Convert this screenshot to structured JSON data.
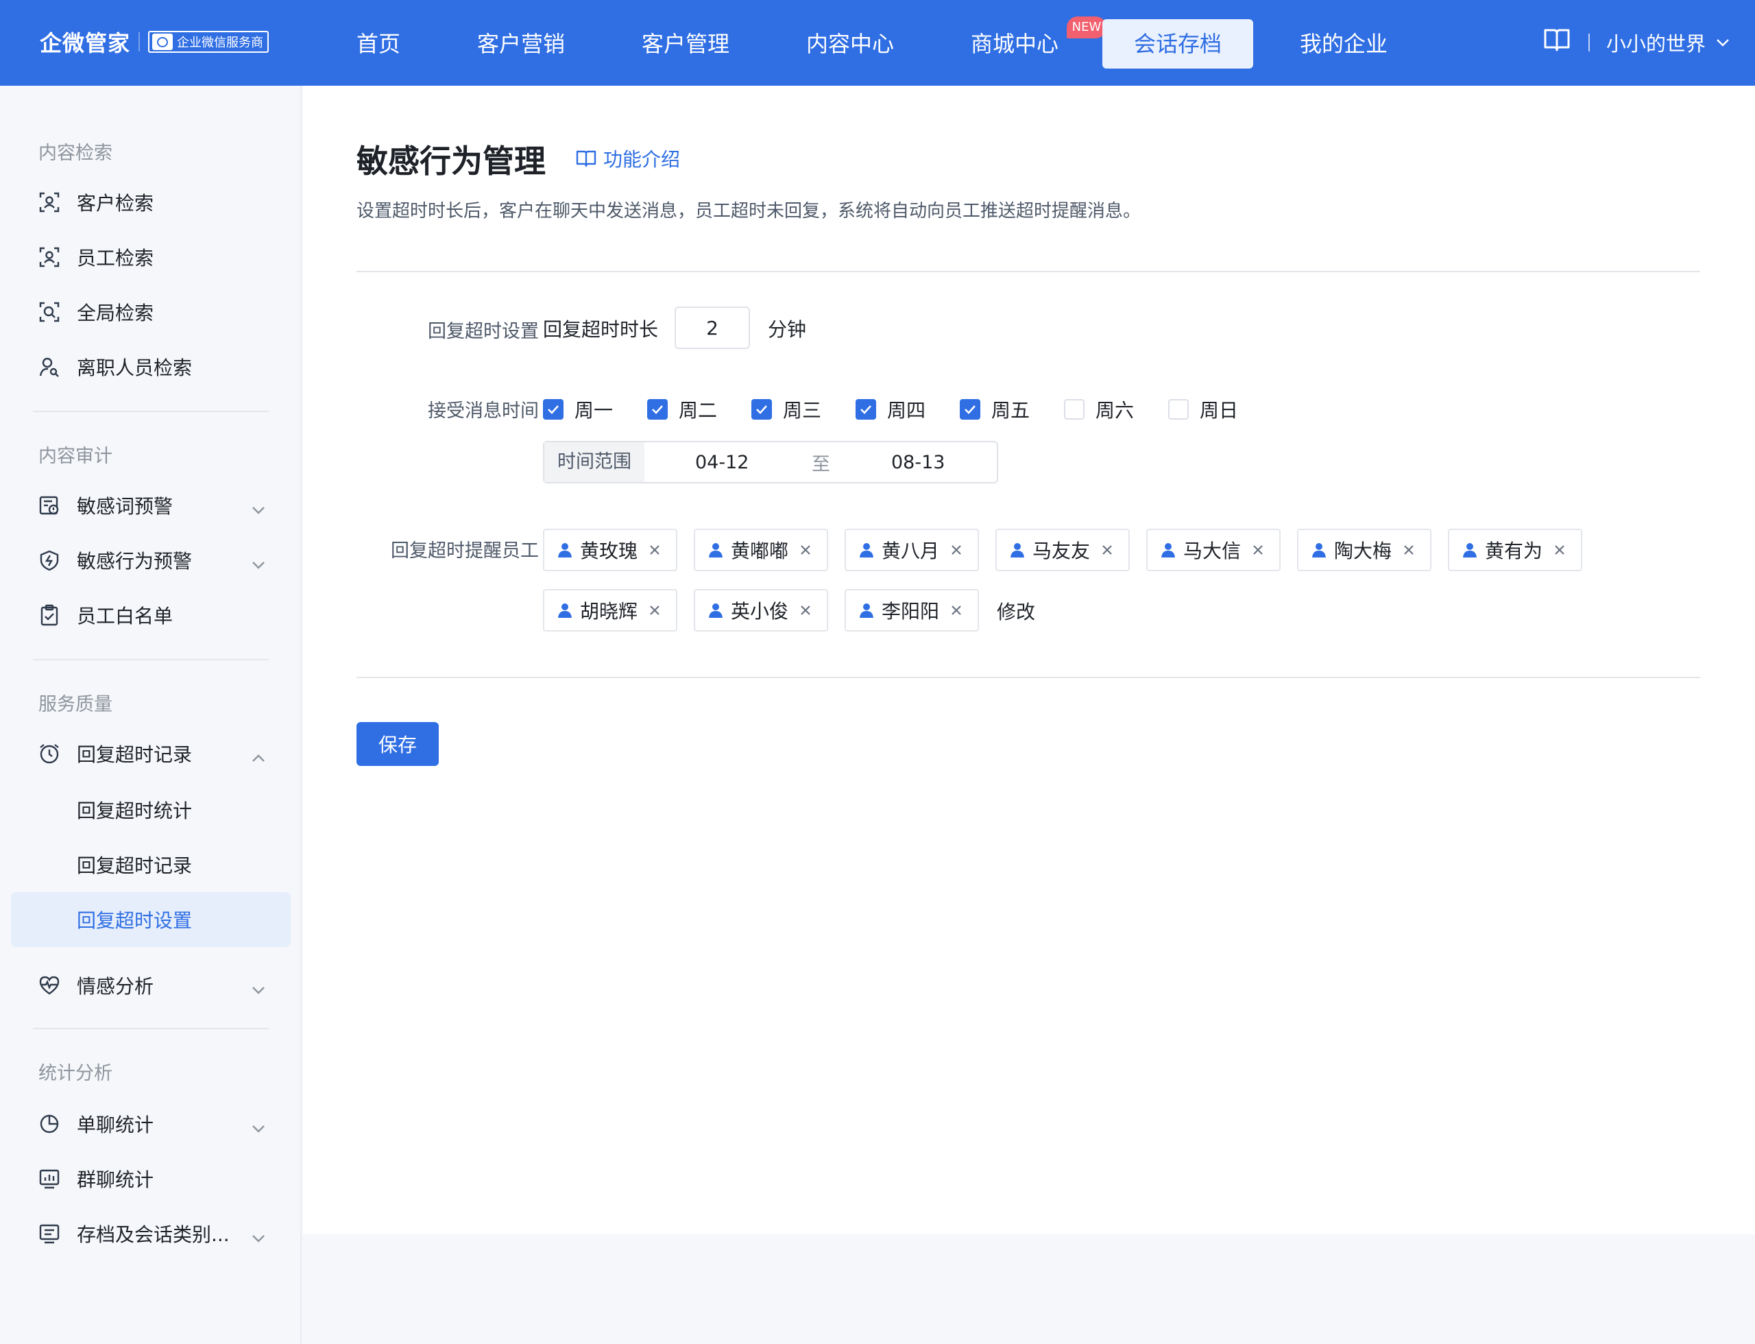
{
  "brand": {
    "name": "企微管家",
    "badge": "企业微信服务商"
  },
  "nav": {
    "items": [
      {
        "label": "首页"
      },
      {
        "label": "客户营销"
      },
      {
        "label": "客户管理"
      },
      {
        "label": "内容中心"
      },
      {
        "label": "商城中心"
      },
      {
        "label": "会话存档"
      },
      {
        "label": "我的企业"
      }
    ],
    "new_badge": "NEW",
    "active_index": 5,
    "user_name": "小小的世界"
  },
  "sidebar": {
    "groups": [
      {
        "title": "内容检索"
      },
      {
        "title": "内容审计"
      },
      {
        "title": "服务质量"
      },
      {
        "title": "统计分析"
      }
    ],
    "items": [
      {
        "label": "客户检索"
      },
      {
        "label": "员工检索"
      },
      {
        "label": "全局检索"
      },
      {
        "label": "离职人员检索"
      },
      {
        "label": "敏感词预警"
      },
      {
        "label": "敏感行为预警"
      },
      {
        "label": "员工白名单"
      },
      {
        "label": "回复超时记录"
      },
      {
        "label": "回复超时统计"
      },
      {
        "label": "回复超时记录"
      },
      {
        "label": "回复超时设置"
      },
      {
        "label": "情感分析"
      },
      {
        "label": "单聊统计"
      },
      {
        "label": "群聊统计"
      },
      {
        "label": "存档及会话类别..."
      }
    ]
  },
  "main": {
    "title": "敏感行为管理",
    "intro_link": "功能介绍",
    "description": "设置超时时长后，客户在聊天中发送消息，员工超时未回复，系统将自动向员工推送超时提醒消息。",
    "timeout": {
      "section_label": "回复超时设置",
      "field_label": "回复超时时长",
      "value": "2",
      "unit": "分钟"
    },
    "receive": {
      "label": "接受消息时间",
      "days": [
        {
          "label": "周一",
          "checked": true
        },
        {
          "label": "周二",
          "checked": true
        },
        {
          "label": "周三",
          "checked": true
        },
        {
          "label": "周四",
          "checked": true
        },
        {
          "label": "周五",
          "checked": true
        },
        {
          "label": "周六",
          "checked": false
        },
        {
          "label": "周日",
          "checked": false
        }
      ],
      "range_label": "时间范围",
      "range_from": "04-12",
      "range_sep": "至",
      "range_to": "08-13"
    },
    "staff": {
      "label": "回复超时提醒员工",
      "names": [
        "黄玫瑰",
        "黄嘟嘟",
        "黄八月",
        "马友友",
        "马大信",
        "陶大梅",
        "黄有为",
        "胡晓辉",
        "英小俊",
        "李阳阳"
      ],
      "modify": "修改"
    },
    "save": "保存"
  },
  "colors": {
    "primary": "#2f6ee3",
    "new_badge": "#f25f6e",
    "active_bg": "#e6eefc"
  }
}
